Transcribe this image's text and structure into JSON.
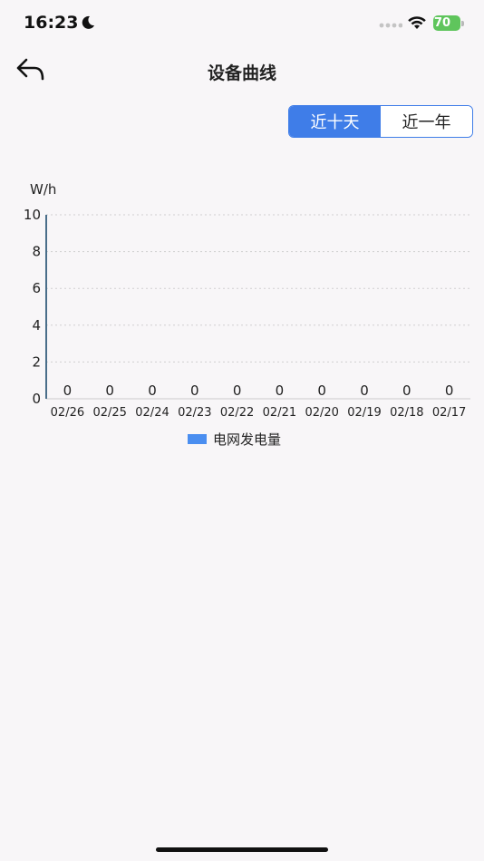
{
  "status_bar": {
    "time": "16:23",
    "battery_level": "70"
  },
  "nav": {
    "title": "设备曲线"
  },
  "segment": {
    "options": [
      "近十天",
      "近一年"
    ],
    "selected_index": 0
  },
  "chart_data": {
    "type": "bar",
    "ylabel": "W/h",
    "ylim": [
      0,
      10
    ],
    "yticks": [
      0,
      2,
      4,
      6,
      8,
      10
    ],
    "grid": true,
    "legend_position": "bottom",
    "categories": [
      "02/26",
      "02/25",
      "02/24",
      "02/23",
      "02/22",
      "02/21",
      "02/20",
      "02/19",
      "02/18",
      "02/17"
    ],
    "series": [
      {
        "name": "电网发电量",
        "values": [
          0,
          0,
          0,
          0,
          0,
          0,
          0,
          0,
          0,
          0
        ],
        "color": "#4a8ef0"
      }
    ],
    "data_labels": true
  },
  "colors": {
    "accent": "#3f7de8",
    "axis": "#4a6e8a",
    "grid": "#cfcfcf",
    "background": "#f8f6f8"
  },
  "icons": {
    "back": "back-arrow-icon",
    "moon": "moon-icon",
    "wifi": "wifi-icon",
    "battery": "battery-icon"
  }
}
